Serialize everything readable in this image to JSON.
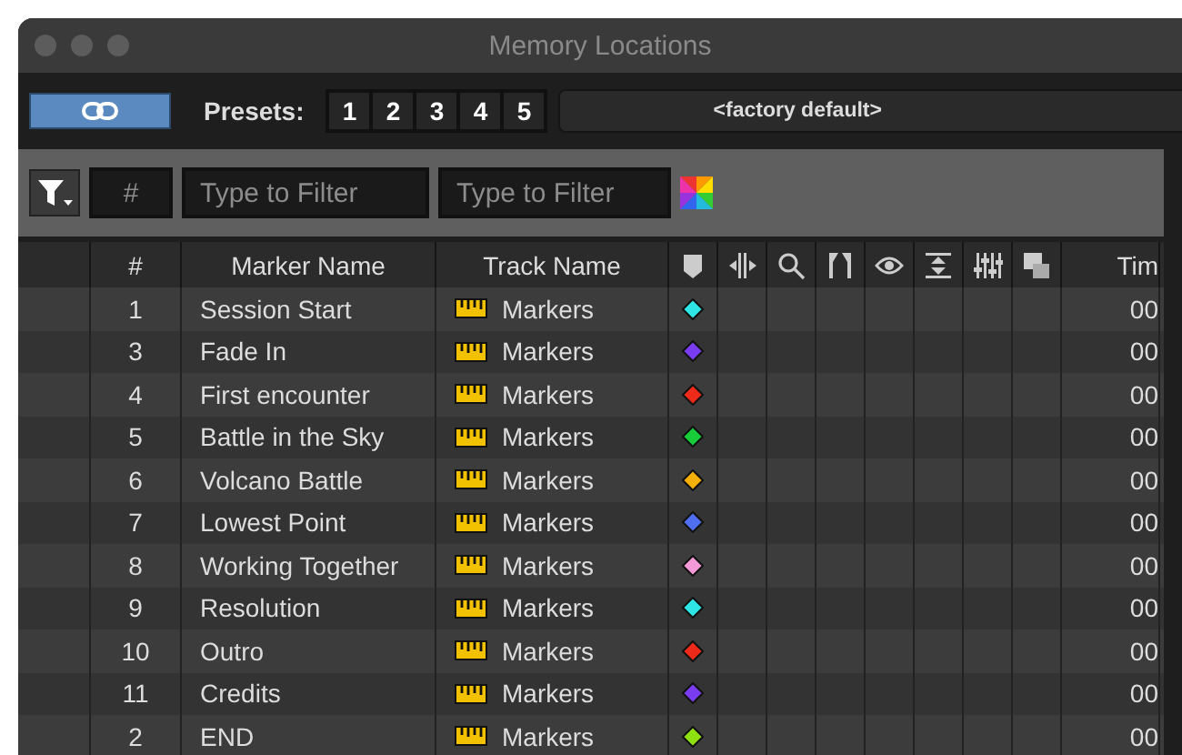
{
  "window": {
    "title": "Memory Locations"
  },
  "toolbar": {
    "link_button": {
      "on": true
    },
    "presets_label": "Presets:",
    "presets": [
      "1",
      "2",
      "3",
      "4",
      "5"
    ],
    "preset_menu": "<factory default>"
  },
  "filters": {
    "number_field": {
      "placeholder": "#"
    },
    "name_field": {
      "placeholder": "Type to Filter"
    },
    "track_field": {
      "placeholder": "Type to Filter"
    }
  },
  "table": {
    "columns": {
      "number": "#",
      "marker_name": "Marker Name",
      "track_name": "Track Name",
      "time": "Tim"
    },
    "rows": [
      {
        "number": "1",
        "name": "Session Start",
        "track": "Markers",
        "color": "#2ee6e6",
        "time": "00"
      },
      {
        "number": "3",
        "name": "Fade In",
        "track": "Markers",
        "color": "#7a3cf0",
        "time": "00"
      },
      {
        "number": "4",
        "name": "First encounter",
        "track": "Markers",
        "color": "#ee2a1a",
        "time": "00"
      },
      {
        "number": "5",
        "name": "Battle in the Sky",
        "track": "Markers",
        "color": "#18cc3a",
        "time": "00"
      },
      {
        "number": "6",
        "name": "Volcano Battle",
        "track": "Markers",
        "color": "#f5b00a",
        "time": "00"
      },
      {
        "number": "7",
        "name": "Lowest Point",
        "track": "Markers",
        "color": "#4f6ef0",
        "time": "00"
      },
      {
        "number": "8",
        "name": "Working Together",
        "track": "Markers",
        "color": "#f59ad8",
        "time": "00"
      },
      {
        "number": "9",
        "name": "Resolution",
        "track": "Markers",
        "color": "#2ee6e6",
        "time": "00"
      },
      {
        "number": "10",
        "name": "Outro",
        "track": "Markers",
        "color": "#ee2a1a",
        "time": "00"
      },
      {
        "number": "11",
        "name": "Credits",
        "track": "Markers",
        "color": "#7a3cf0",
        "time": "00"
      },
      {
        "number": "2",
        "name": "END",
        "track": "Markers",
        "color": "#8ee010",
        "time": "00"
      }
    ]
  }
}
